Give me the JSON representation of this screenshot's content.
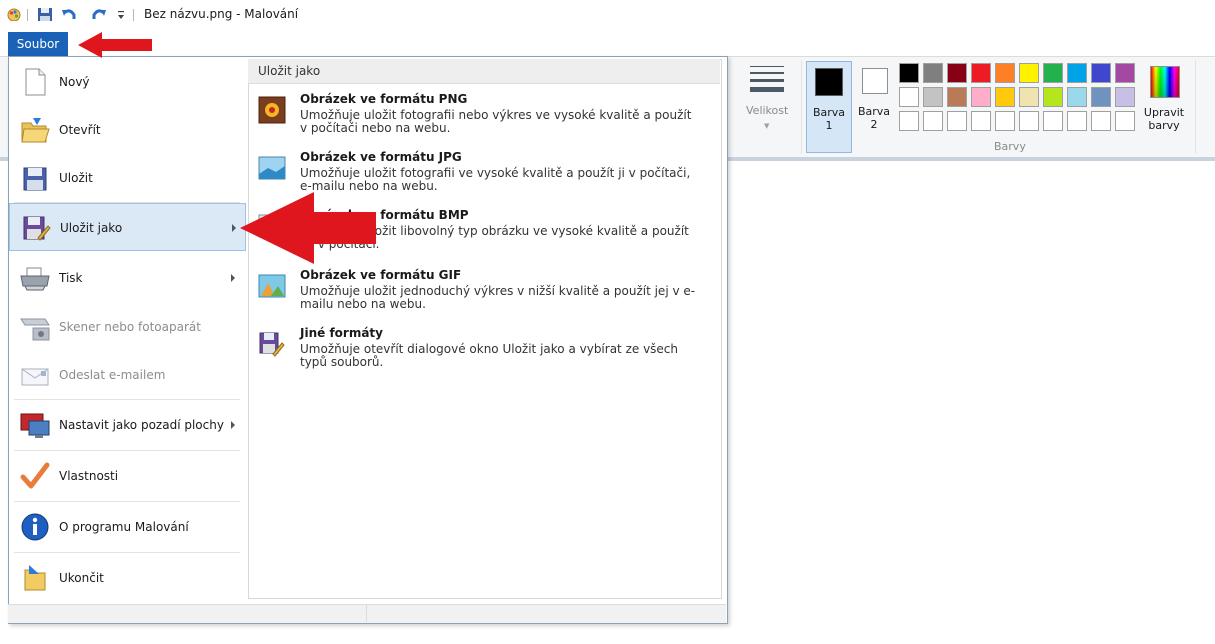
{
  "window": {
    "title": "Bez názvu.png - Malování"
  },
  "quick_access": {
    "icons": [
      "paint-app-icon",
      "save-icon",
      "undo-icon",
      "redo-icon",
      "customize-dropdown-icon"
    ]
  },
  "ribbon": {
    "file_tab_label": "Soubor",
    "size_label": "Velikost",
    "color1_label_line1": "Barva",
    "color1_label_line2": "1",
    "color2_label_line1": "Barva",
    "color2_label_line2": "2",
    "edit_colors_line1": "Upravit",
    "edit_colors_line2": "barvy",
    "colors_group_label": "Barvy",
    "color1_value": "#000000",
    "color2_value": "#ffffff",
    "palette_row1": [
      "#000000",
      "#7f7f7f",
      "#880015",
      "#ed1c24",
      "#ff7f27",
      "#fff200",
      "#22b14c",
      "#00a2e8",
      "#3f48cc",
      "#a349a4"
    ],
    "palette_row2": [
      "#ffffff",
      "#c3c3c3",
      "#b97a57",
      "#ffaec9",
      "#ffc90e",
      "#efe4b0",
      "#b5e61d",
      "#99d9ea",
      "#7092be",
      "#c8bfe7"
    ],
    "palette_row3": [
      "#ffffff",
      "#ffffff",
      "#ffffff",
      "#ffffff",
      "#ffffff",
      "#ffffff",
      "#ffffff",
      "#ffffff",
      "#ffffff",
      "#ffffff"
    ]
  },
  "file_menu": {
    "items": [
      {
        "label": "Nový"
      },
      {
        "label": "Otevřít"
      },
      {
        "label": "Uložit"
      },
      {
        "label": "Uložit jako"
      },
      {
        "label": "Tisk"
      },
      {
        "label": "Skener nebo fotoaparát"
      },
      {
        "label": "Odeslat e-mailem"
      },
      {
        "label": "Nastavit jako pozadí plochy"
      },
      {
        "label": "Vlastnosti"
      },
      {
        "label": "O programu Malování"
      },
      {
        "label": "Ukončit"
      }
    ],
    "submenu": {
      "header": "Uložit jako",
      "items": [
        {
          "title": "Obrázek ve formátu PNG",
          "desc": "Umožňuje uložit fotografii nebo výkres ve vysoké kvalitě a použít v počítači nebo na webu."
        },
        {
          "title": "Obrázek ve formátu JPG",
          "desc": "Umožňuje uložit fotografii ve vysoké kvalitě a použít ji v počítači, e-mailu nebo na webu."
        },
        {
          "title": "Obrázek ve formátu BMP",
          "desc": "Umožňuje uložit libovolný typ obrázku ve vysoké kvalitě a použít jej v počítači."
        },
        {
          "title": "Obrázek ve formátu GIF",
          "desc": "Umožňuje uložit jednoduchý výkres v nižší kvalitě a použít jej v e-mailu nebo na webu."
        },
        {
          "title": "Jiné formáty",
          "desc": "Umožňuje otevřít dialogové okno Uložit jako a vybírat ze všech typů souborů."
        }
      ]
    }
  },
  "annotation_color": "#e0161e"
}
